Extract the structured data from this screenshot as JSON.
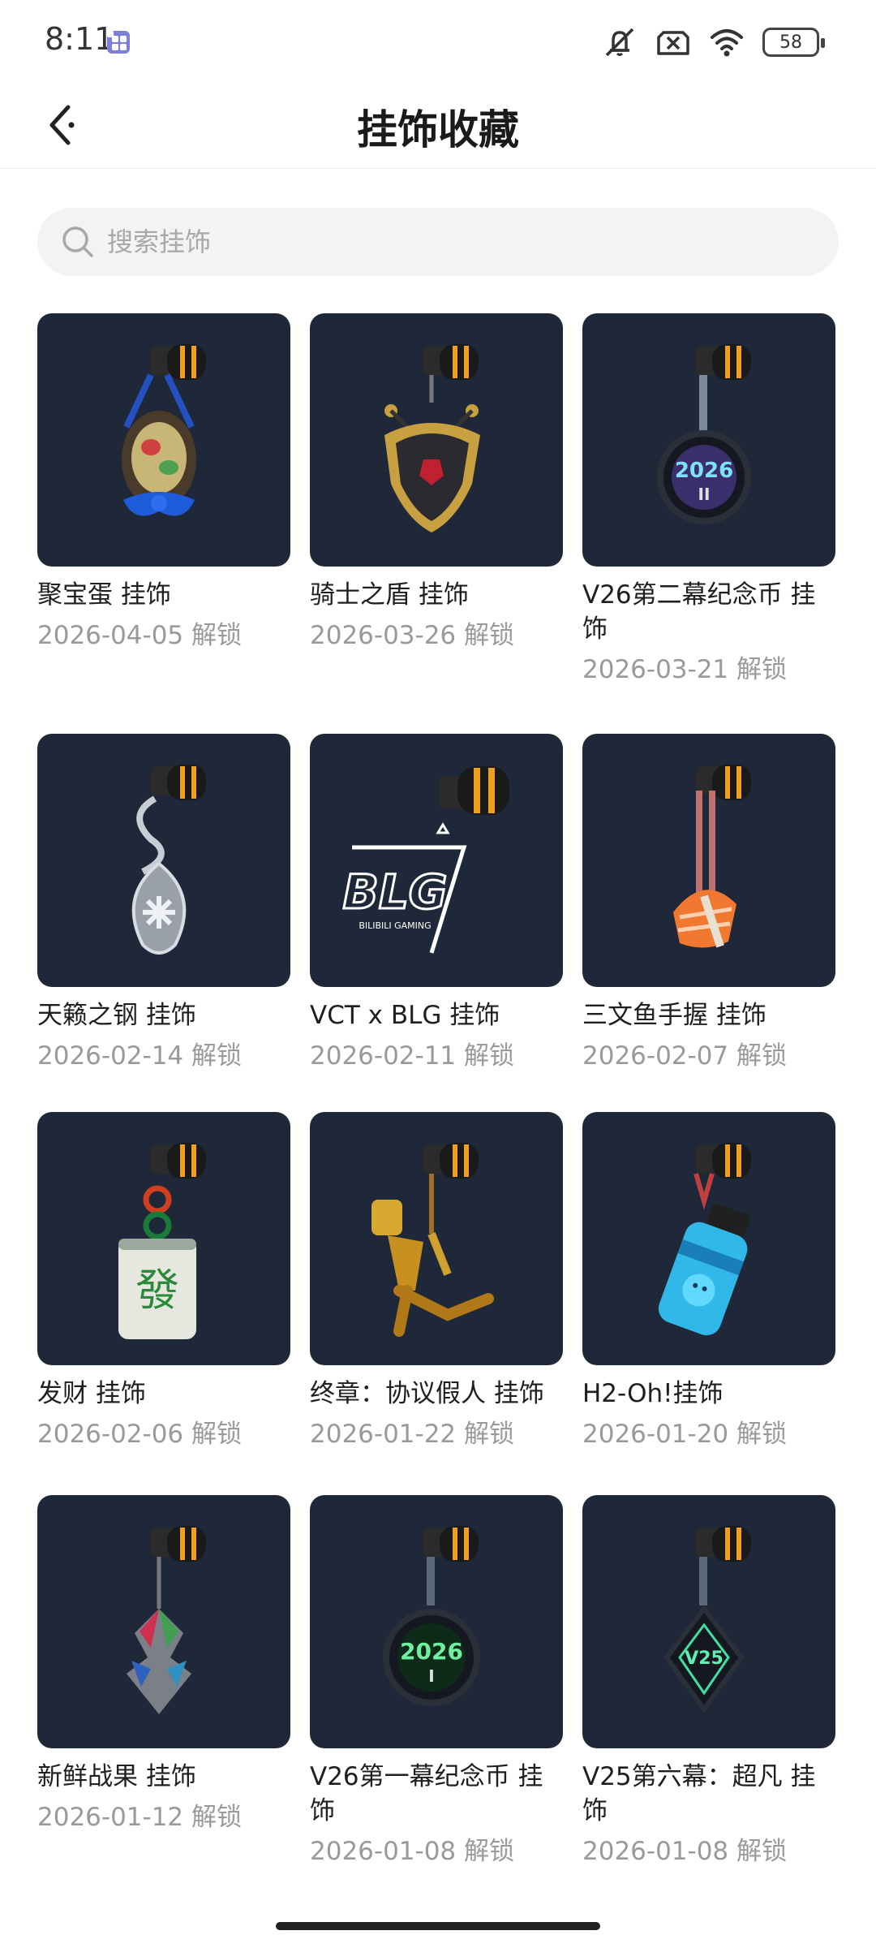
{
  "status_bar": {
    "time": "8:11",
    "battery": "58",
    "icons": [
      "app-badge-icon",
      "mute-icon",
      "sim-x-icon",
      "wifi-icon",
      "battery-icon"
    ]
  },
  "header": {
    "title": "挂饰收藏",
    "back_icon": "chevron-left-icon"
  },
  "search": {
    "placeholder": "搜索挂饰",
    "value": ""
  },
  "items": [
    {
      "name": "聚宝蛋 挂饰",
      "date": "2026-04-05 解锁"
    },
    {
      "name": "骑士之盾 挂饰",
      "date": "2026-03-26 解锁"
    },
    {
      "name": "V26第二幕纪念币 挂饰",
      "date": "2026-03-21 解锁"
    },
    {
      "name": "天籁之钢 挂饰",
      "date": "2026-02-14 解锁"
    },
    {
      "name": "VCT x BLG 挂饰",
      "date": "2026-02-11 解锁"
    },
    {
      "name": "三文鱼手握 挂饰",
      "date": "2026-02-07 解锁"
    },
    {
      "name": "发财 挂饰",
      "date": "2026-02-06 解锁"
    },
    {
      "name": "终章：协议假人 挂饰",
      "date": "2026-01-22 解锁"
    },
    {
      "name": "H2-Oh!挂饰",
      "date": "2026-01-20 解锁"
    },
    {
      "name": "新鲜战果 挂饰",
      "date": "2026-01-12 解锁"
    },
    {
      "name": "V26第一幕纪念币 挂饰",
      "date": "2026-01-08 解锁"
    },
    {
      "name": "V25第六幕：超凡 挂饰",
      "date": "2026-01-08 解锁"
    }
  ],
  "thumb_texts": {
    "coin_v26_2": "2026",
    "coin_v26_2_sub": "II",
    "blg_logo": "BLG",
    "blg_sub": "BILIBILI GAMING",
    "mahjong": "發",
    "coin_v26_1": "2026",
    "coin_v26_1_sub": "I",
    "v25": "V25"
  },
  "colors": {
    "thumb_bg": "#1f2838",
    "clip_orange": "#f0a020",
    "title": "#1a1a1a",
    "date": "#9a9a9a"
  }
}
